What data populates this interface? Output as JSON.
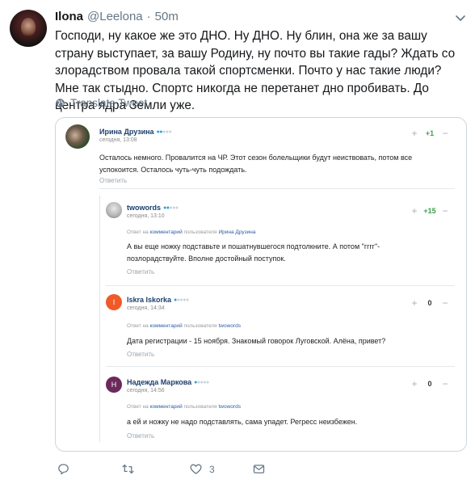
{
  "tweet": {
    "name": "Ilona",
    "handle": "@Leelona",
    "separator": "·",
    "time": "50m",
    "text": "Господи, ну какое же это ДНО. Ну ДНО. Ну блин, она же за вашу страну выступает, за вашу Родину, ну почто вы такие гады? Ждать со злорадством провала такой спортсменки. Почто у нас такие люди? Мне так стыдно. Спортс никогда не перетанет дно пробивать. До центра ядра Земли уже.",
    "translate_label": "Translate Tweet"
  },
  "embed": {
    "comments": [
      {
        "author": "Ирина Друзина",
        "date": "сегодня, 13:08",
        "score": "+1",
        "text": "Осталось немного. Провалится на ЧР. Этот сезон болельщики будут неиствовать, потом все успокоится. Осталось чуть-чуть подождать.",
        "reply_label": "Ответить"
      },
      {
        "author": "twowords",
        "date": "сегодня, 13:10",
        "score": "+15",
        "reply_prefix": "Ответ на",
        "reply_link": "комментарий",
        "reply_mid": "пользователя",
        "reply_user": "Ирина Друзина",
        "text": "А вы еще ножку подставьте и пошатнувшегося подтолкните. А потом \"гггг\"- позлорадствуйте. Вполне достойный поступок.",
        "reply_label": "Ответить"
      },
      {
        "author": "Iskra Iskorka",
        "avatar_letter": "I",
        "date": "сегодня, 14:34",
        "score": "0",
        "reply_prefix": "Ответ на",
        "reply_link": "комментарий",
        "reply_mid": "пользователя",
        "reply_user": "twowords",
        "text": "Дата регистрации - 15 ноября. Знакомый говорок Луговской. Алёна, привет?",
        "reply_label": "Ответить"
      },
      {
        "author": "Надежда Маркова",
        "avatar_letter": "Н",
        "date": "сегодня, 14:56",
        "score": "0",
        "reply_prefix": "Ответ на",
        "reply_link": "комментарий",
        "reply_mid": "пользователя",
        "reply_user": "twowords",
        "text": "а ей и ножку не надо подставлять, сама упадет. Регресс неизбежен.",
        "reply_label": "Ответить"
      }
    ]
  },
  "actions": {
    "reply_count": "",
    "retweet_count": "",
    "like_count": "3"
  },
  "colors": {
    "text_secondary": "#657786",
    "link_blue": "#1d3e6a",
    "score_green": "#3ca14a",
    "iskra_avatar": "#f05a28",
    "nadezhda_avatar": "#6b2a5b"
  }
}
